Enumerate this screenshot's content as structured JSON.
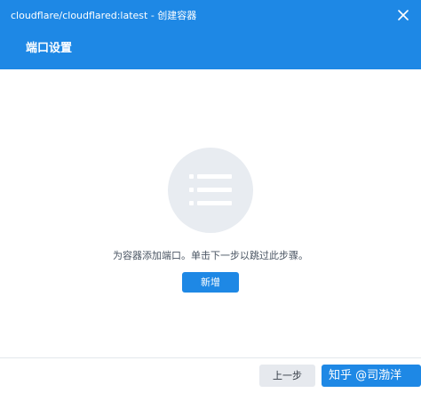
{
  "window": {
    "title": "cloudflare/cloudflared:latest - 创建容器",
    "close_icon": "close-icon"
  },
  "header": {
    "step_title": "端口设置"
  },
  "empty_state": {
    "icon": "list-icon",
    "message": "为容器添加端口。单击下一步以跳过此步骤。",
    "add_label": "新增"
  },
  "footer": {
    "prev_label": "上一步",
    "watermark": "知乎 @司渤洋"
  },
  "colors": {
    "accent": "#1e88e5",
    "illustration_bg": "#e8ecf1",
    "secondary_button": "#e6e9ee"
  }
}
